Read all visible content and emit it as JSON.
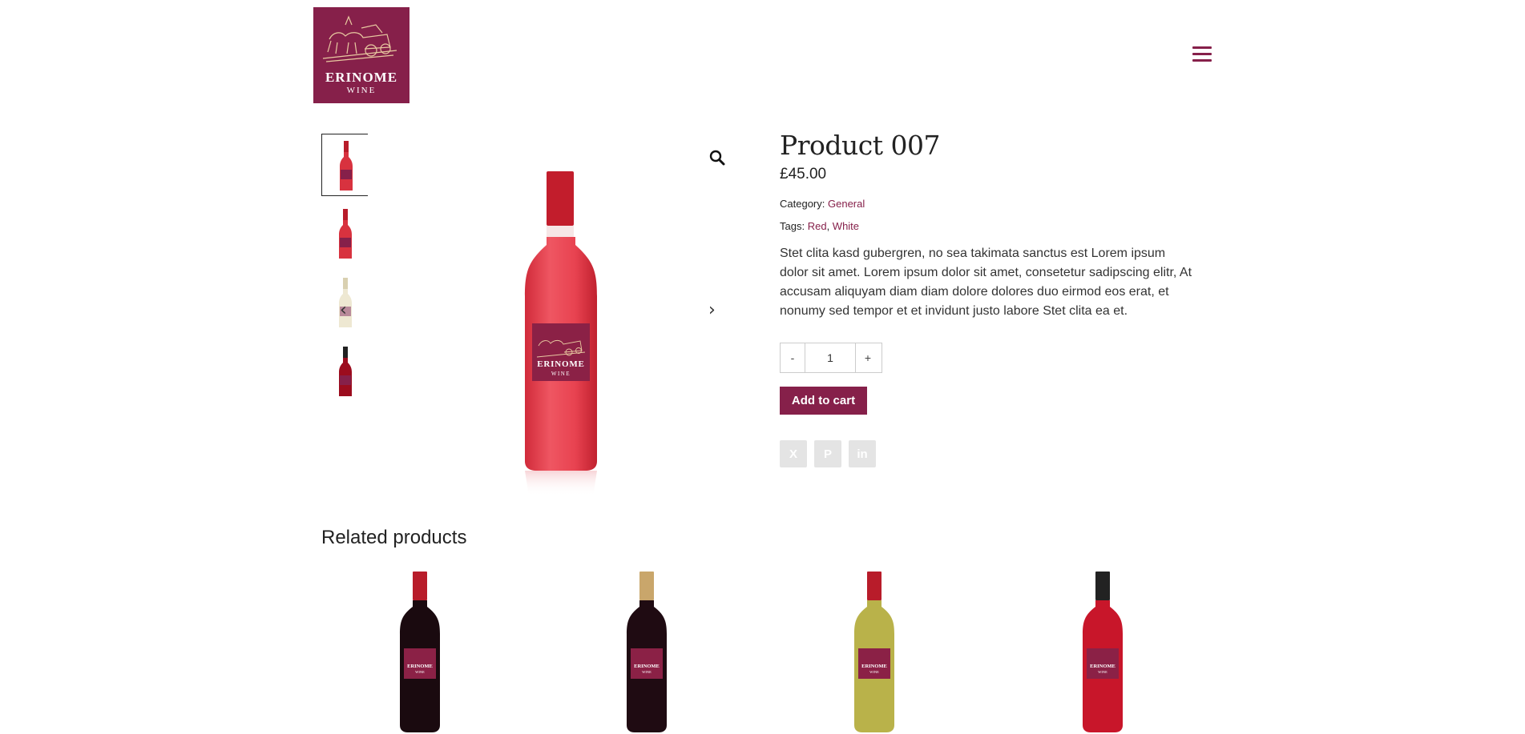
{
  "brand": {
    "logo_name": "ERINOME",
    "logo_sub": "WINE",
    "color": "#86204a"
  },
  "header": {
    "menu_icon": "hamburger-menu-icon"
  },
  "gallery": {
    "thumbnails": [
      {
        "liquid": "#d8323f",
        "cap": "#b81c2a"
      },
      {
        "liquid": "#d8323f",
        "cap": "#b81c2a"
      },
      {
        "liquid": "#eee8d2",
        "cap": "#d9d0b0"
      },
      {
        "liquid": "#9c0c1e",
        "cap": "#222222"
      }
    ],
    "main_liquid": "#e94552",
    "main_cap": "#c21d2c",
    "prev_icon": "chevron-left-icon",
    "next_icon": "chevron-right-icon",
    "zoom_icon": "magnifier-icon",
    "prev_glyph": "‹",
    "next_glyph": "›"
  },
  "product": {
    "title": "Product 007",
    "price": "£45.00",
    "category_label": "Category:",
    "category": "General",
    "tags_label": "Tags:",
    "tags": [
      "Red",
      "White"
    ],
    "tag_separator": ", ",
    "description": "Stet clita kasd gubergren, no sea takimata sanctus est Lorem ipsum dolor sit amet. Lorem ipsum dolor sit amet, consetetur sadipscing elitr, At accusam aliquyam diam diam dolore dolores duo eirmod eos erat, et nonumy sed tempor et et invidunt justo labore Stet clita ea et.",
    "quantity": "1",
    "qty_minus": "-",
    "qty_plus": "+",
    "add_to_cart": "Add to cart"
  },
  "share": {
    "twitter_glyph": "X",
    "pinterest_glyph": "P",
    "linkedin_glyph": "in"
  },
  "related": {
    "title": "Related products",
    "items": [
      {
        "liquid": "#1a0a0f",
        "cap": "#b81c2a"
      },
      {
        "liquid": "#1f0b12",
        "cap": "#c9a66b"
      },
      {
        "liquid": "#b9b24a",
        "cap": "#b81c2a"
      },
      {
        "liquid": "#c8162a",
        "cap": "#222222"
      }
    ]
  }
}
